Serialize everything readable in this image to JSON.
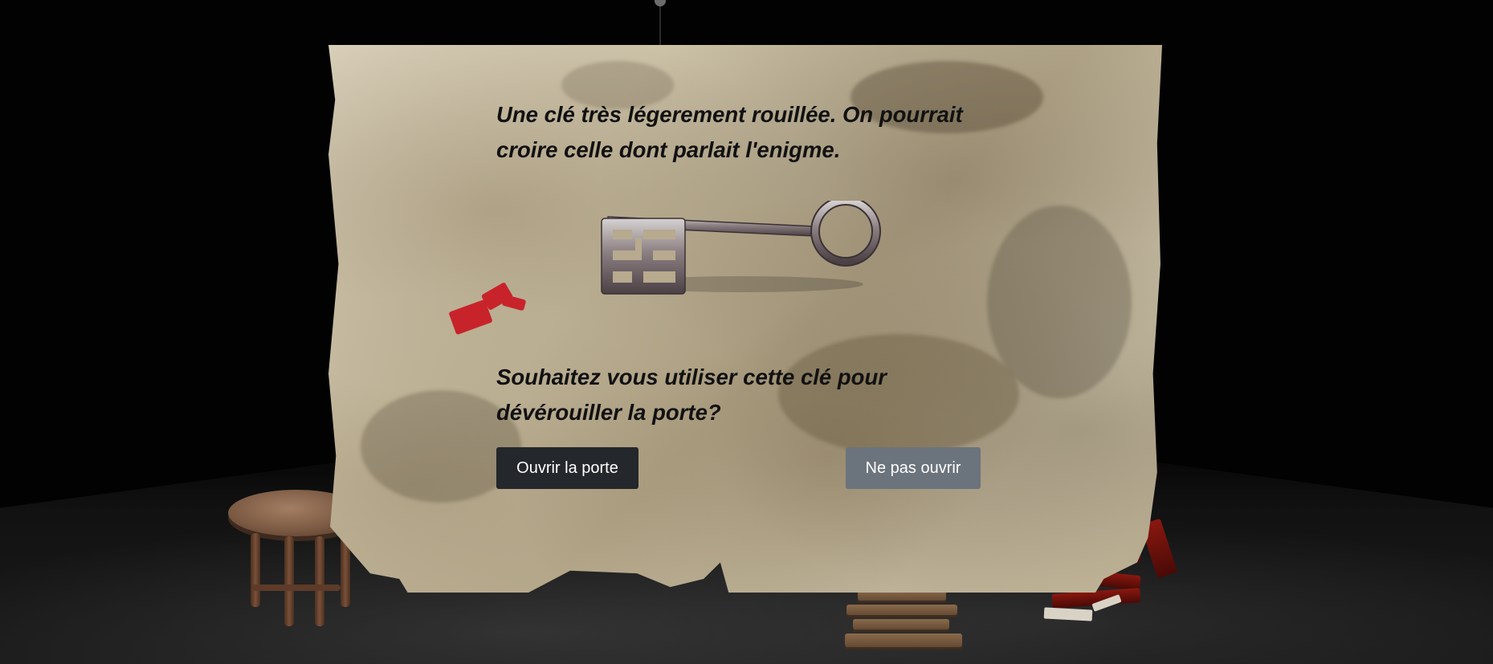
{
  "dialog": {
    "description": "Une clé très légerement rouillée. On pourrait croire celle dont parlait l'enigme.",
    "question": "Souhaitez vous utiliser cette clé pour dévérouiller la porte?",
    "open_button": "Ouvrir la porte",
    "cancel_button": "Ne pas ouvrir"
  },
  "item": {
    "icon": "rusty-key-icon"
  },
  "colors": {
    "primary_button": "#24272b",
    "secondary_button": "#6b737d",
    "wax_seal": "#c8232a"
  }
}
